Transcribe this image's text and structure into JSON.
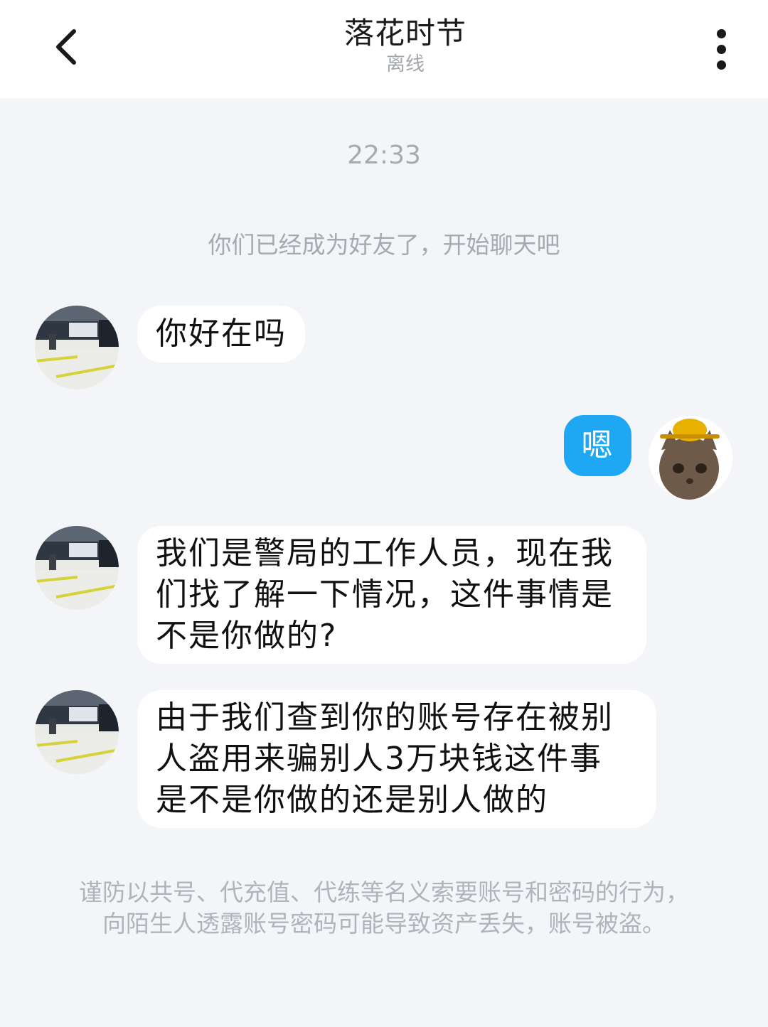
{
  "header": {
    "back_icon": "chevron-left-icon",
    "title": "落花时节",
    "status": "离线",
    "more_icon": "more-vertical-icon"
  },
  "chat": {
    "timestamp": "22:33",
    "system_note": "你们已经成为好友了，开始聊天吧",
    "messages": [
      {
        "sender": "other",
        "text": "你好在吗"
      },
      {
        "sender": "me",
        "text": "嗯"
      },
      {
        "sender": "other",
        "lines": [
          "我们是警局的工作人员，现在我",
          "们找了解一下情况，这件事情是",
          "不是你做的?"
        ]
      },
      {
        "sender": "other",
        "lines": [
          "由于我们查到你的账号存在被别",
          "人盗用来骗别人3万块钱这件事",
          "是不是你做的还是别人做的"
        ]
      }
    ],
    "footer_note": {
      "line1": "谨防以共号、代充值、代练等名义索要账号和密码的行为，",
      "line2": "向陌生人透露账号密码可能导致资产丢失，账号被盗。"
    }
  },
  "colors": {
    "background": "#f3f5f8",
    "header_bg": "#ffffff",
    "my_bubble": "#1ea8f4",
    "other_bubble": "#ffffff",
    "muted_text": "#a6aab0"
  }
}
